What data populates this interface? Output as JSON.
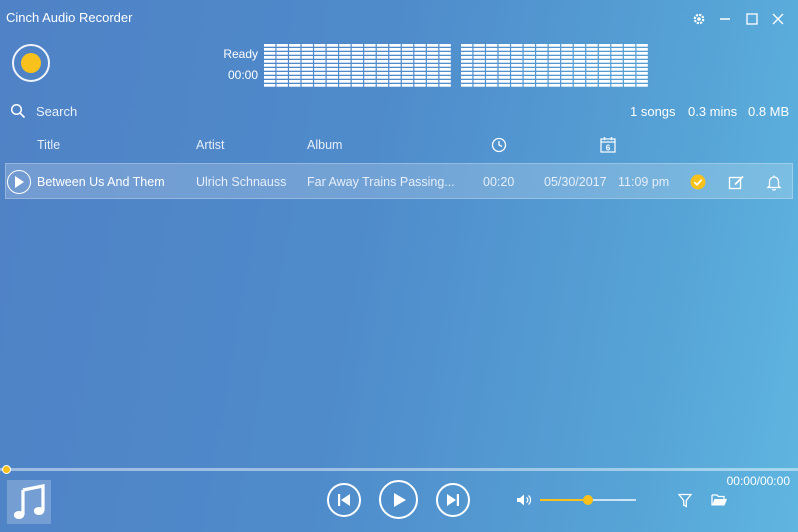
{
  "app": {
    "title": "Cinch Audio Recorder"
  },
  "recorder": {
    "status": "Ready",
    "elapsed": "00:00"
  },
  "meter": {
    "level": 1.0
  },
  "search": {
    "placeholder": "Search"
  },
  "stats": {
    "songs": "1 songs",
    "mins": "0.3 mins",
    "size": "0.8 MB"
  },
  "columns": {
    "title": "Title",
    "artist": "Artist",
    "album": "Album",
    "duration_icon": "clock-icon",
    "date_icon": "calendar-icon",
    "date_icon_number": "6"
  },
  "tracks": [
    {
      "title": "Between Us And Them",
      "artist": "Ulrich Schnauss",
      "album": "Far Away Trains Passing...",
      "duration": "00:20",
      "date": "05/30/2017",
      "time": "11:09 pm",
      "status": "done"
    }
  ],
  "player": {
    "time": "00:00/00:00",
    "progress": 0.0,
    "volume": 0.5
  },
  "colors": {
    "accent": "#f8c11b",
    "background_left": "#4f82c6",
    "background_right": "#5fb6e0"
  }
}
